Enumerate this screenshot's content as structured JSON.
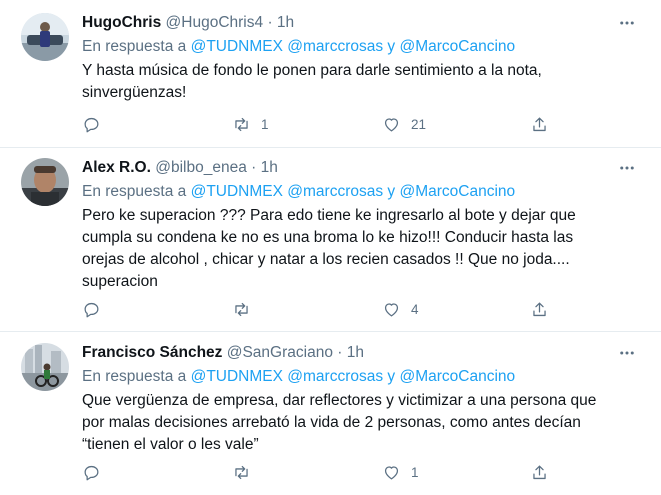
{
  "reply_prefix": "En respuesta a",
  "tweets": [
    {
      "name": "HugoChris",
      "handle": "@HugoChris4",
      "time": "1h",
      "mentions": [
        "@TUDNMEX",
        "@marccrosas",
        "y",
        "@MarcoCancino"
      ],
      "text": "Y hasta música de fondo le ponen para darle sentimiento a la nota,\nsinvergüenzas!",
      "replies": "",
      "retweets": "1",
      "likes": "21"
    },
    {
      "name": "Alex R.O.",
      "handle": "@bilbo_enea",
      "time": "1h",
      "mentions": [
        "@TUDNMEX",
        "@marccrosas",
        "y",
        "@MarcoCancino"
      ],
      "text": "Pero ke superacion ???  Para edo tiene ke ingresarlo al bote y dejar que\ncumpla su condena ke no es una broma lo ke hizo!!!  Conducir hasta las\norejas de alcohol , chicar y natar a los recien casados !! Que no joda....\nsuperacion",
      "replies": "",
      "retweets": "",
      "likes": "4"
    },
    {
      "name": "Francisco Sánchez",
      "handle": "@SanGraciano",
      "time": "1h",
      "mentions": [
        "@TUDNMEX",
        "@marccrosas",
        "y",
        "@MarcoCancino"
      ],
      "text": "Que vergüenza de empresa, dar reflectores y victimizar a una persona que\npor malas decisiones arrebató la vida de 2 personas, como antes decían\n“tienen el valor o les vale”",
      "replies": "",
      "retweets": "",
      "likes": "1"
    }
  ],
  "colors": {
    "accent": "#1da1f2",
    "secondary_text": "#5b7083",
    "primary_text": "#0f1419",
    "divider": "#e6ecf0"
  }
}
